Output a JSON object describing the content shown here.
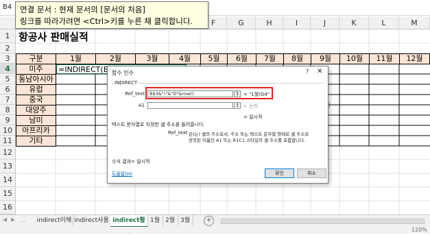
{
  "name_box": "B4",
  "tooltip": {
    "line1": "연결 문서 : 현재 문서의 [문서의 처음]",
    "line2": "링크를 따라가려면 <Ctrl>키를 누른 채 클릭합니다."
  },
  "columns": [
    "A",
    "B",
    "C",
    "D",
    "E",
    "F",
    "G",
    "H",
    "I",
    "J",
    "K",
    "L",
    "M"
  ],
  "rows": [
    "1",
    "2",
    "3",
    "4",
    "5",
    "6",
    "7",
    "8",
    "9",
    "10",
    "11",
    "12",
    "13",
    "14",
    "15",
    "16"
  ],
  "sheet_title": "항공사 판매실적",
  "header_row": [
    "구분",
    "1월",
    "2월",
    "3월",
    "4월",
    "5월",
    "6월",
    "7월",
    "8월",
    "9월",
    "10월",
    "11월",
    "12월"
  ],
  "regions": [
    "미주",
    "동남아시아",
    "유럽",
    "중국",
    "대양주",
    "남미",
    "아프리카",
    "기타"
  ],
  "editing_formula": "=INDIRECT(B$3&\"!\"&\"D\"&row()",
  "dialog": {
    "title": "함수 인수",
    "help": "?",
    "close": "✕",
    "function_name": "INDIRECT",
    "args": [
      {
        "label": "Ref_text",
        "value": "B$3&\"!\"&\"D\"&row()",
        "result": "= \"1월!D4\""
      },
      {
        "label": "A1",
        "value": "",
        "result": "= 논리"
      }
    ],
    "result_line": "= 일시적",
    "description": "텍스트 문자열로 지정한 셀 주소를 돌려줍니다.",
    "arg_help_label": "Ref_text",
    "arg_help_line1": "은(는) 셀의 주소로서, 주소 또는 텍스트 문자열 형태로 셀 주소로",
    "arg_help_line2": "정의된 이름인 A1 또는 R1C1 스타일의 셀 주소를 포함합니다.",
    "formula_result": "수식 결과= 일시적",
    "help_link": "도움말(H)",
    "ok": "확인",
    "cancel": "취소"
  },
  "tabs": [
    "indirect이해",
    "indirect사용",
    "indirect활용",
    "1월",
    "2월",
    "3월"
  ],
  "add_sheet": "+",
  "status_left": "",
  "zoom": "120%"
}
